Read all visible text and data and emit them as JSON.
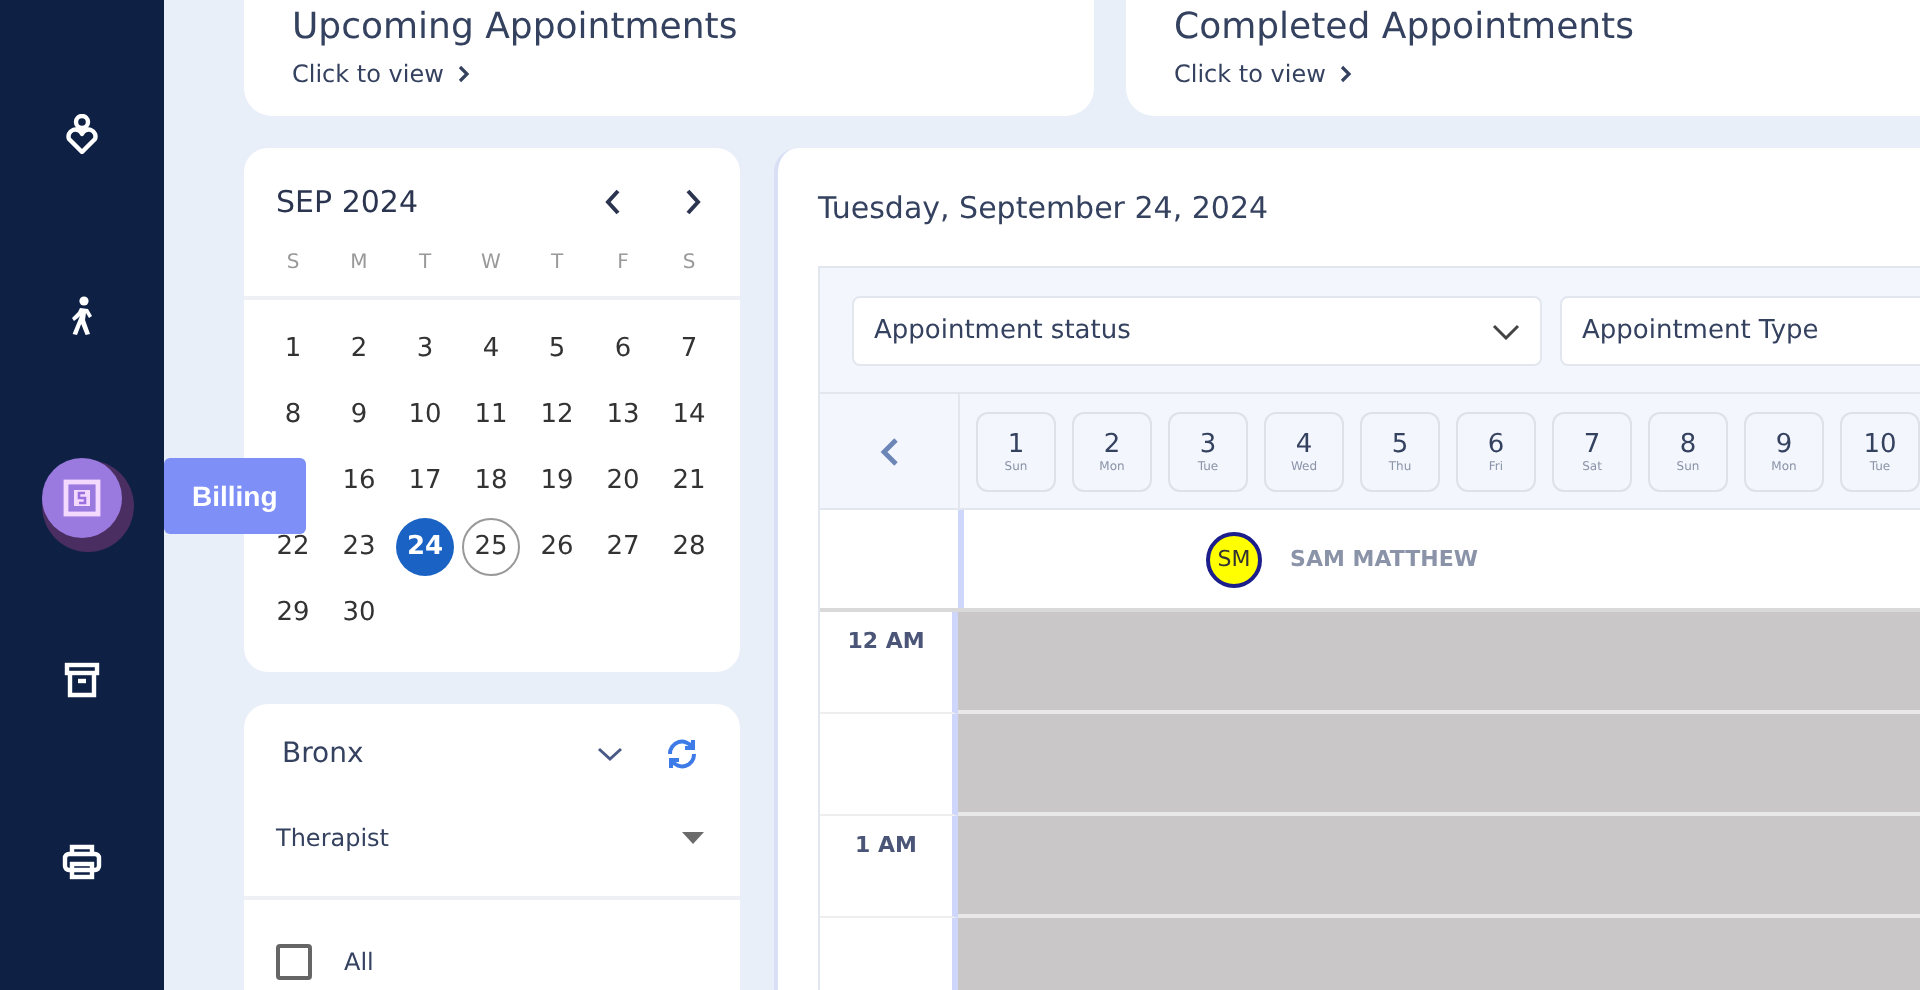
{
  "sidebar": {
    "items": [
      {
        "selected": false
      },
      {
        "selected": false
      },
      {
        "selected": true,
        "tooltip": "Billing"
      },
      {
        "selected": false
      },
      {
        "selected": false
      }
    ]
  },
  "summary_cards": [
    {
      "title": "Upcoming Appointments",
      "link": "Click to view"
    },
    {
      "title": "Completed Appointments",
      "link": "Click to view"
    }
  ],
  "mini_calendar": {
    "month": "SEP 2024",
    "weekdays": [
      "S",
      "M",
      "T",
      "W",
      "T",
      "F",
      "S"
    ],
    "weeks": [
      [
        {
          "kind": "day",
          "day": "1",
          "selected": false,
          "today": false
        },
        {
          "kind": "day",
          "day": "2",
          "selected": false,
          "today": false
        },
        {
          "kind": "day",
          "day": "3",
          "selected": false,
          "today": false
        },
        {
          "kind": "day",
          "day": "4",
          "selected": false,
          "today": false
        },
        {
          "kind": "day",
          "day": "5",
          "selected": false,
          "today": false
        },
        {
          "kind": "day",
          "day": "6",
          "selected": false,
          "today": false
        },
        {
          "kind": "day",
          "day": "7",
          "selected": false,
          "today": false
        }
      ],
      [
        {
          "kind": "day",
          "day": "8",
          "selected": false,
          "today": false
        },
        {
          "kind": "day",
          "day": "9",
          "selected": false,
          "today": false
        },
        {
          "kind": "day",
          "day": "10",
          "selected": false,
          "today": false
        },
        {
          "kind": "day",
          "day": "11",
          "selected": false,
          "today": false
        },
        {
          "kind": "day",
          "day": "12",
          "selected": false,
          "today": false
        },
        {
          "kind": "day",
          "day": "13",
          "selected": false,
          "today": false
        },
        {
          "kind": "day",
          "day": "14",
          "selected": false,
          "today": false
        }
      ],
      [
        {
          "kind": "covered"
        },
        {
          "kind": "day",
          "day": "16",
          "selected": false,
          "today": false
        },
        {
          "kind": "day",
          "day": "17",
          "selected": false,
          "today": false
        },
        {
          "kind": "day",
          "day": "18",
          "selected": false,
          "today": false
        },
        {
          "kind": "day",
          "day": "19",
          "selected": false,
          "today": false
        },
        {
          "kind": "day",
          "day": "20",
          "selected": false,
          "today": false
        },
        {
          "kind": "day",
          "day": "21",
          "selected": false,
          "today": false
        }
      ],
      [
        {
          "kind": "day",
          "day": "22",
          "selected": false,
          "today": false
        },
        {
          "kind": "day",
          "day": "23",
          "selected": false,
          "today": false
        },
        {
          "kind": "day",
          "day": "24",
          "selected": true,
          "today": false
        },
        {
          "kind": "day",
          "day": "25",
          "selected": false,
          "today": true
        },
        {
          "kind": "day",
          "day": "26",
          "selected": false,
          "today": false
        },
        {
          "kind": "day",
          "day": "27",
          "selected": false,
          "today": false
        },
        {
          "kind": "day",
          "day": "28",
          "selected": false,
          "today": false
        }
      ],
      [
        {
          "kind": "day",
          "day": "29",
          "selected": false,
          "today": false
        },
        {
          "kind": "day",
          "day": "30",
          "selected": false,
          "today": false
        }
      ]
    ]
  },
  "filters": {
    "location": "Bronx",
    "role": "Therapist",
    "options": [
      {
        "label": "All",
        "checked": false
      }
    ]
  },
  "schedule": {
    "date_title": "Tuesday, September 24, 2024",
    "dropdowns": [
      {
        "placeholder": "Appointment status"
      },
      {
        "placeholder": "Appointment Type"
      }
    ],
    "days": [
      {
        "day": "1",
        "weekday": "Sun"
      },
      {
        "day": "2",
        "weekday": "Mon"
      },
      {
        "day": "3",
        "weekday": "Tue"
      },
      {
        "day": "4",
        "weekday": "Wed"
      },
      {
        "day": "5",
        "weekday": "Thu"
      },
      {
        "day": "6",
        "weekday": "Fri"
      },
      {
        "day": "7",
        "weekday": "Sat"
      },
      {
        "day": "8",
        "weekday": "Sun"
      },
      {
        "day": "9",
        "weekday": "Mon"
      },
      {
        "day": "10",
        "weekday": "Tue"
      }
    ],
    "provider": {
      "initials": "SM",
      "name": "SAM MATTHEW"
    },
    "time_slots": [
      {
        "kind": "hour",
        "label": "12 AM"
      },
      {
        "kind": "half"
      },
      {
        "kind": "hour",
        "label": "1 AM"
      },
      {
        "kind": "half"
      }
    ]
  }
}
